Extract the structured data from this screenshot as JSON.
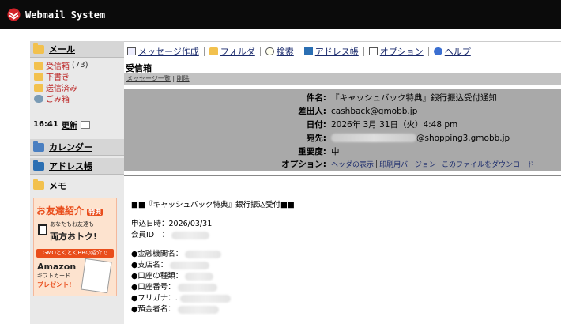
{
  "app": {
    "title": "Webmail System"
  },
  "sidebar": {
    "mail_label": "メール",
    "folders": [
      {
        "label": "受信箱",
        "count": "(73)"
      },
      {
        "label": "下書き",
        "count": ""
      },
      {
        "label": "送信済み",
        "count": ""
      },
      {
        "label": "ごみ箱",
        "count": ""
      }
    ],
    "time": "16:41",
    "refresh_label": "更新",
    "calendar_label": "カレンダー",
    "addressbook_label": "アドレス帳",
    "memo_label": "メモ",
    "promo": {
      "headline": "お友達紹介",
      "badge": "特典",
      "line1": "あなたもお友達も",
      "line2": "両方おトク!",
      "banner": "GMOとくとくBBの紹介で",
      "brand": "Amazon",
      "card": "ギフトカード",
      "present": "プレゼント!"
    }
  },
  "toolbar": {
    "items": [
      {
        "label": "メッセージ作成",
        "icon": "compose-icon"
      },
      {
        "label": "フォルダ",
        "icon": "folder-icon"
      },
      {
        "label": "検索",
        "icon": "search-icon"
      },
      {
        "label": "アドレス帳",
        "icon": "addressbook-icon"
      },
      {
        "label": "オプション",
        "icon": "options-icon"
      },
      {
        "label": "ヘルプ",
        "icon": "help-icon"
      }
    ]
  },
  "main": {
    "section_title": "受信箱",
    "crumb_list": "メッセージ一覧",
    "crumb_sep": "|",
    "crumb_delete": "削除"
  },
  "header": {
    "subject_label": "件名:",
    "subject": "『キャッシュバック特典』銀行振込受付通知",
    "from_label": "差出人:",
    "from": "cashback@gmobb.jp",
    "date_label": "日付:",
    "date": "2026年 3月 31日（火）4:48 pm",
    "to_label": "宛先:",
    "to_suffix": "@shopping3.gmobb.jp",
    "priority_label": "重要度:",
    "priority": "中",
    "options_label": "オプション:",
    "opt_headers": "ヘッダの表示",
    "opt_print": "印刷用バージョン",
    "opt_download": "このファイルをダウンロード",
    "opt_sep": "|"
  },
  "message": {
    "title": "■■『キャッシュバック特典』銀行振込受付■■",
    "applied": "申込日時：2026/03/31",
    "member_id": "会員ID　：",
    "bank": "●金融機関名：",
    "branch": "●支店名：",
    "acct_type": "●口座の種類：",
    "acct_no": "●口座番号：",
    "furigana": "●フリガナ：.",
    "holder": "●預金者名："
  },
  "colors": {
    "topbar": "#0b0b0b",
    "header_box": "#a9a9a9",
    "sidebar": "#e9e9e9",
    "link": "#1a2a6c",
    "folder_text": "#b22222",
    "promo_accent": "#e94d1b"
  }
}
